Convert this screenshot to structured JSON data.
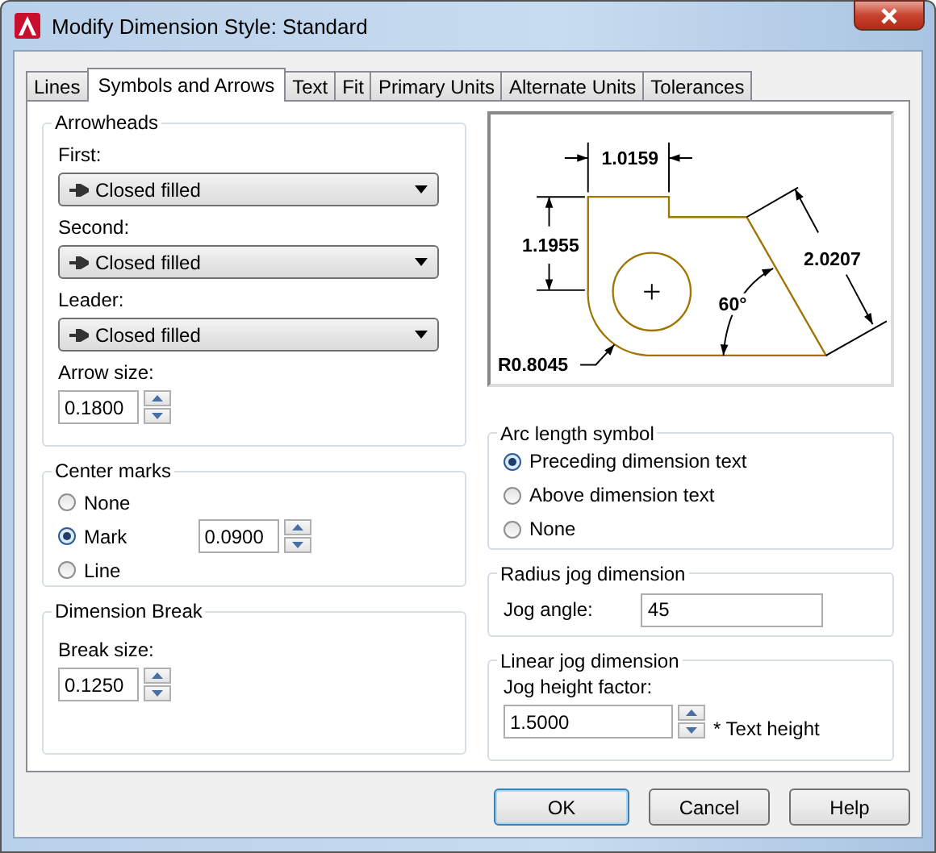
{
  "window": {
    "title": "Modify Dimension Style: Standard"
  },
  "tabs": [
    {
      "label": "Lines",
      "selected": false
    },
    {
      "label": "Symbols and Arrows",
      "selected": true
    },
    {
      "label": "Text",
      "selected": false
    },
    {
      "label": "Fit",
      "selected": false
    },
    {
      "label": "Primary Units",
      "selected": false
    },
    {
      "label": "Alternate Units",
      "selected": false
    },
    {
      "label": "Tolerances",
      "selected": false
    }
  ],
  "arrowheads": {
    "title": "Arrowheads",
    "fields": [
      {
        "label": "First:",
        "value": "Closed filled"
      },
      {
        "label": "Second:",
        "value": "Closed filled"
      },
      {
        "label": "Leader:",
        "value": "Closed filled"
      }
    ],
    "arrow_size": {
      "label": "Arrow size:",
      "value": "0.1800"
    }
  },
  "center_marks": {
    "title": "Center marks",
    "options": [
      {
        "label": "None",
        "selected": false
      },
      {
        "label": "Mark",
        "selected": true
      },
      {
        "label": "Line",
        "selected": false
      }
    ],
    "size": {
      "value": "0.0900"
    }
  },
  "dimension_break": {
    "title": "Dimension Break",
    "break_size": {
      "label": "Break size:",
      "value": "0.1250"
    }
  },
  "preview": {
    "labels": [
      "1.0159",
      "1.1955",
      "2.0207",
      "60°",
      "R0.8045"
    ]
  },
  "arc_length_symbol": {
    "title": "Arc length symbol",
    "options": [
      {
        "label": "Preceding dimension text",
        "selected": true
      },
      {
        "label": "Above dimension text",
        "selected": false
      },
      {
        "label": "None",
        "selected": false
      }
    ]
  },
  "radius_jog": {
    "title": "Radius jog dimension",
    "jog_angle": {
      "label": "Jog angle:",
      "value": "45"
    }
  },
  "linear_jog": {
    "title": "Linear jog dimension",
    "height_factor": {
      "label": "Jog height factor:",
      "value": "1.5000",
      "suffix": "* Text height"
    }
  },
  "buttons": [
    {
      "label": "OK",
      "default": true
    },
    {
      "label": "Cancel",
      "default": false
    },
    {
      "label": "Help",
      "default": false
    }
  ]
}
